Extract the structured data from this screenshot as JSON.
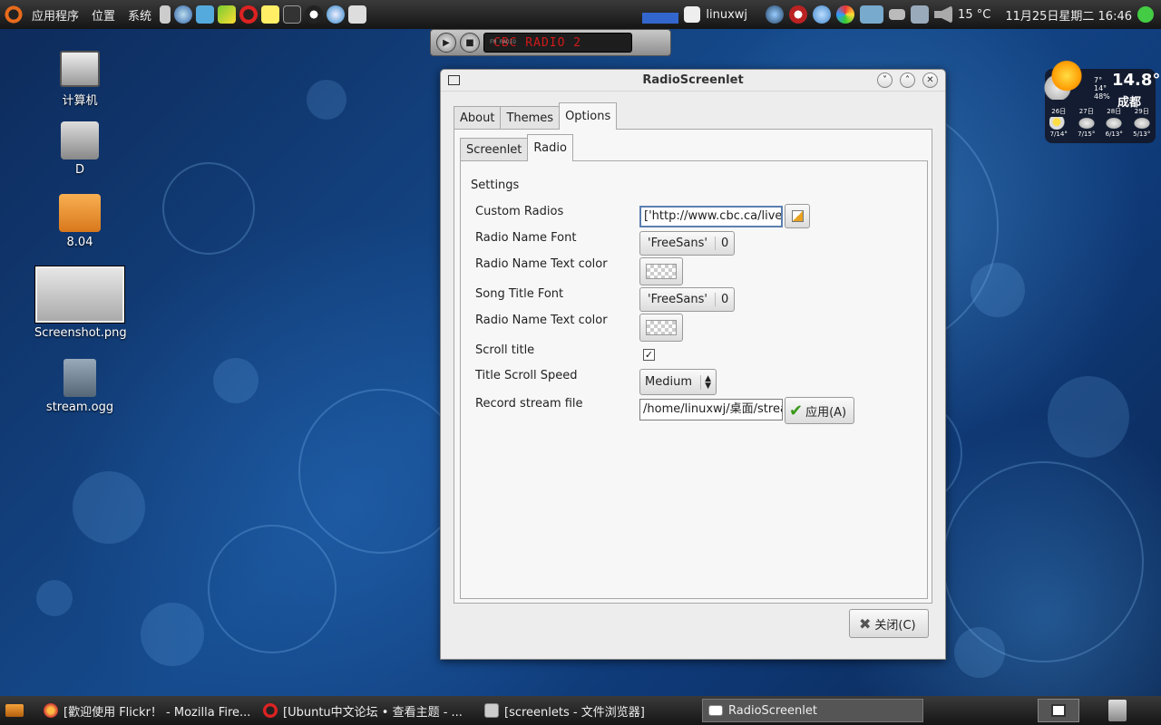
{
  "top_panel": {
    "menus": [
      "应用程序",
      "位置",
      "系统"
    ],
    "user": "linuxwj",
    "temperature": "15 °C",
    "clock": "11月25日星期二 16:46"
  },
  "radio_widget": {
    "label": "FM RADIO",
    "station": "CBC RADIO 2"
  },
  "desktop_icons": [
    {
      "label": "计算机"
    },
    {
      "label": "D"
    },
    {
      "label": "8.04"
    },
    {
      "label": "Screenshot.png"
    },
    {
      "label": "stream.ogg"
    }
  ],
  "weather": {
    "now_temp": "14.8°",
    "city": "成都",
    "detail": [
      "7°",
      "14°",
      "48%"
    ],
    "forecast": [
      {
        "day": "26日",
        "range": "7/14°"
      },
      {
        "day": "27日",
        "range": "7/15°"
      },
      {
        "day": "28日",
        "range": "6/13°"
      },
      {
        "day": "29日",
        "range": "5/13°"
      }
    ]
  },
  "window": {
    "title": "RadioScreenlet",
    "tabs": [
      "About",
      "Themes",
      "Options"
    ],
    "subtabs": [
      "Screenlet",
      "Radio"
    ],
    "section": "Settings",
    "rows": {
      "custom_radios": {
        "label": "Custom Radios",
        "value": "['http://www.cbc.ca/livem"
      },
      "radio_name_font": {
        "label": "Radio Name Font",
        "font": "'FreeSans'",
        "size": "0"
      },
      "radio_name_color": {
        "label": "Radio Name Text color"
      },
      "song_title_font": {
        "label": "Song Title Font",
        "font": "'FreeSans'",
        "size": "0"
      },
      "radio_name_color2": {
        "label": "Radio Name Text color"
      },
      "scroll_title": {
        "label": "Scroll title",
        "checked": true
      },
      "title_scroll_speed": {
        "label": "Title Scroll Speed",
        "value": "Medium"
      },
      "record_stream_file": {
        "label": "Record stream file",
        "value": "/home/linuxwj/桌面/strea",
        "apply_label": "应用(A)"
      }
    },
    "close_label": "关闭(C)"
  },
  "taskbar": {
    "tasks": [
      {
        "label": "[歡迎使用 Flickr！ - Mozilla Fire..."
      },
      {
        "label": "[Ubuntu中文论坛 • 查看主题 - ..."
      },
      {
        "label": "[screenlets - 文件浏览器]"
      },
      {
        "label": "RadioScreenlet"
      }
    ]
  }
}
